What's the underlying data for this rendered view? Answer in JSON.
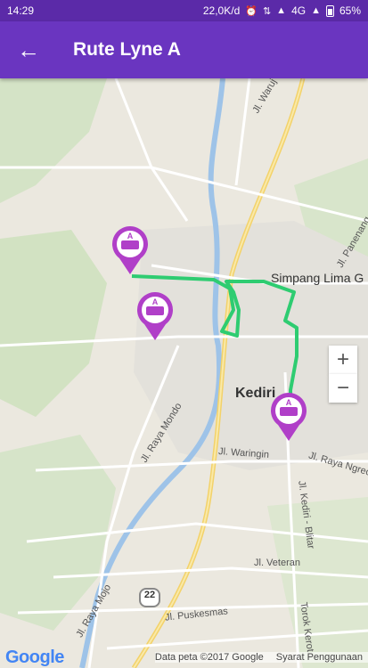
{
  "status_bar": {
    "time": "14:29",
    "speed": "22,0K/d",
    "network": "4G",
    "battery": "65%",
    "icons": [
      "alarm-icon",
      "data-transfer-icon",
      "signal-icon",
      "signal-icon"
    ]
  },
  "app_bar": {
    "title": "Rute Lyne A",
    "back_icon": "arrow-back-icon"
  },
  "map": {
    "labels": {
      "city": "Kediri",
      "simpang": "Simpang Lima G",
      "waruj": "Jl. Waruj",
      "panenang": "Jl. Panenang",
      "raya_mondo": "Jl. Raya Mondo",
      "waringin": "Jl. Waringin",
      "raya_ngreco": "Jl. Raya Ngreco",
      "kediri_blitar": "Jl. Kediri - Blitar",
      "veteran": "Jl. Veteran",
      "raya_mojo": "Jl. Raya Mojo",
      "puskesmas": "Jl. Puskesmas",
      "route_num": "22",
      "torok": "Torok Kerot"
    },
    "route_color": "#2ecc71",
    "marker_color": "#b03fc8",
    "marker_icon": "bus-a-icon",
    "zoom_in": "+",
    "zoom_out": "−"
  },
  "footer": {
    "logo": "Google",
    "data_credit": "Data peta ©2017 Google",
    "terms": "Syarat Penggunaan"
  }
}
